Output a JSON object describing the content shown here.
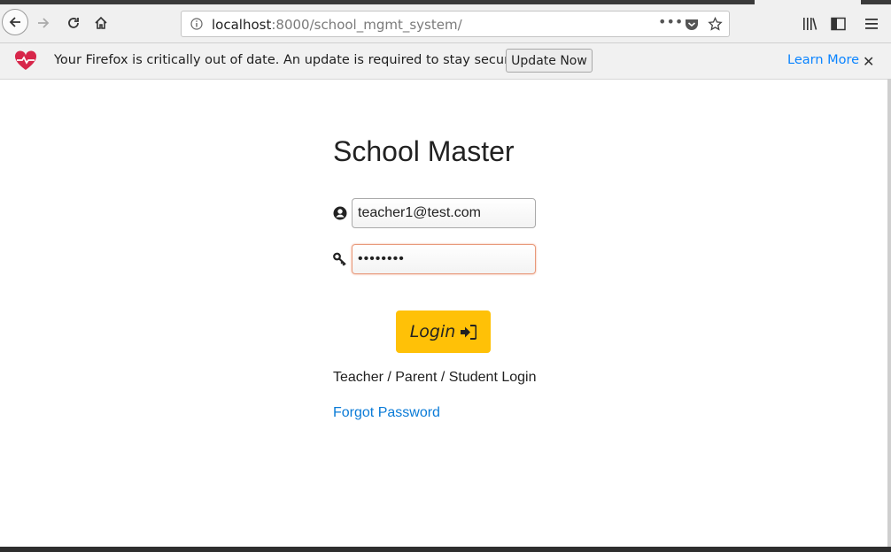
{
  "browser": {
    "url_host": "localhost",
    "url_rest": ":8000/school_mgmt_system/",
    "icons": [
      "back-icon",
      "forward-icon",
      "reload-icon",
      "home-icon",
      "info-icon",
      "more-icon",
      "pocket-icon",
      "bookmark-star-icon",
      "library-icon",
      "sidebar-icon",
      "menu-icon"
    ]
  },
  "notification": {
    "message": "Your Firefox is critically out of date. An update is required to stay secure.",
    "update_label": "Update Now",
    "learn_more_label": "Learn More",
    "icon": "heart-pulse-icon"
  },
  "login": {
    "title": "School Master",
    "email_value": "teacher1@test.com",
    "password_value": "••••••••",
    "login_label": "Login",
    "subtitle": "Teacher / Parent / Student Login",
    "forgot_label": "Forgot Password"
  },
  "colors": {
    "accent_button": "#ffc107",
    "link": "#0a7bd7",
    "firefox_link": "#0a84ff",
    "heart": "#d7264a"
  }
}
